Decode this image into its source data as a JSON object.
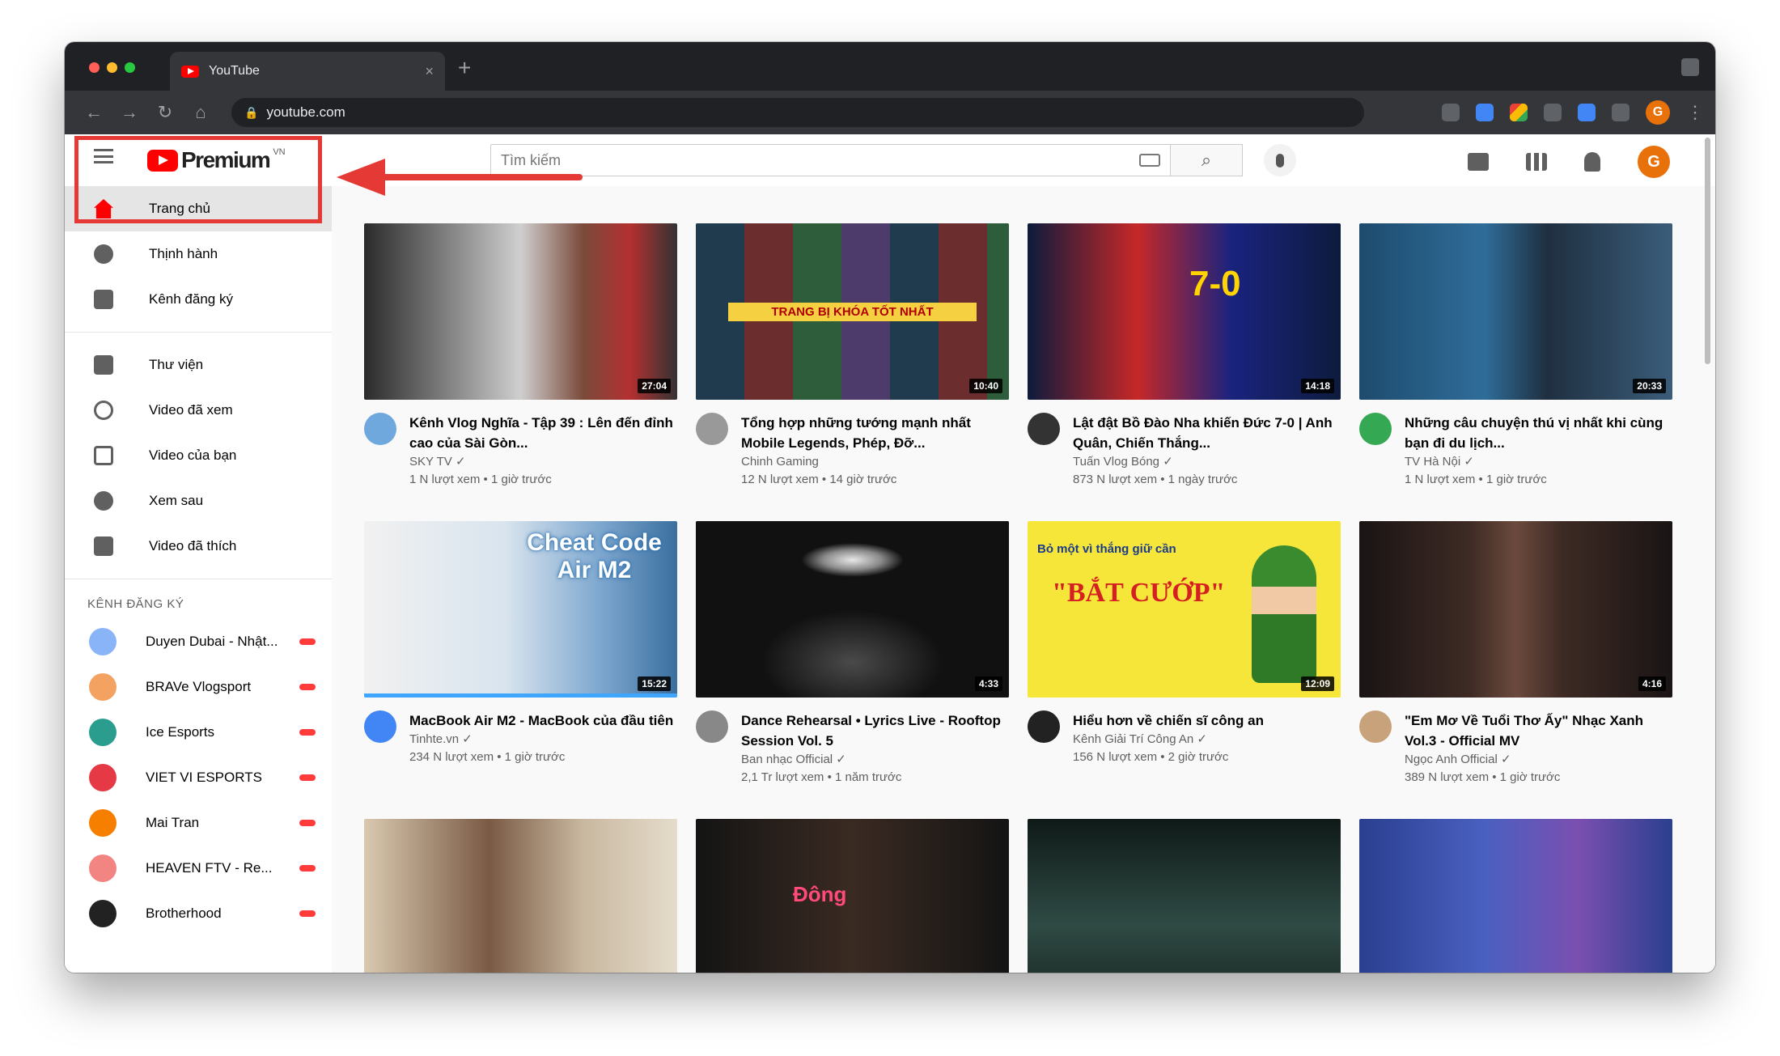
{
  "browser": {
    "tab_title": "YouTube",
    "tab_close": "×",
    "new_tab": "+",
    "url": "youtube.com",
    "profile_initial": "G",
    "traffic_colors": [
      "#ff5f57",
      "#febc2e",
      "#28c840"
    ]
  },
  "youtube": {
    "logo_text": "Premium",
    "region": "VN",
    "search_placeholder": "Tìm kiếm",
    "account_initial": "G",
    "sidebar_primary": [
      {
        "label": "Trang chủ",
        "icon": "home-icon"
      },
      {
        "label": "Thịnh hành",
        "icon": "flame-icon"
      },
      {
        "label": "Kênh đăng ký",
        "icon": "subscriptions-icon"
      }
    ],
    "sidebar_library": [
      {
        "label": "Thư viện",
        "icon": "library-icon"
      },
      {
        "label": "Video đã xem",
        "icon": "history-icon"
      },
      {
        "label": "Video của bạn",
        "icon": "your-videos-icon"
      },
      {
        "label": "Xem sau",
        "icon": "clock-icon"
      },
      {
        "label": "Video đã thích",
        "icon": "thumbs-up-icon"
      }
    ],
    "subscriptions_header": "KÊNH ĐĂNG KÝ",
    "subscriptions": [
      {
        "label": "Duyen Dubai - Nhật...",
        "color": "#8ab4f8"
      },
      {
        "label": "BRAVe Vlogsport",
        "color": "#f4a261"
      },
      {
        "label": "Ice Esports",
        "color": "#2a9d8f"
      },
      {
        "label": "VIET VI ESPORTS",
        "color": "#e63946"
      },
      {
        "label": "Mai Tran",
        "color": "#f77f00"
      },
      {
        "label": "HEAVEN FTV - Re...",
        "color": "#f28482"
      },
      {
        "label": "Brotherhood",
        "color": "#222222"
      }
    ],
    "videos": [
      {
        "title": "Kênh Vlog Nghĩa - Tập 39 : Lên đến đỉnh cao của Sài Gòn...",
        "channel": "SKY TV ✓",
        "stats": "1 N lượt xem • 1 giờ trước",
        "duration": "27:04",
        "channel_color": "#6fa8dc"
      },
      {
        "title": "Tổng hợp những tướng mạnh nhất Mobile Legends, Phép, Đỡ...",
        "channel": "Chinh Gaming",
        "stats": "12 N lượt xem • 14 giờ trước",
        "duration": "10:40",
        "channel_color": "#999999"
      },
      {
        "title": "Lật đật Bồ Đào Nha khiến Đức 7-0 | Anh Quân, Chiến Thắng...",
        "channel": "Tuấn Vlog Bóng ✓",
        "stats": "873 N lượt xem • 1 ngày trước",
        "duration": "14:18",
        "channel_color": "#333333"
      },
      {
        "title": "Những câu chuyện thú vị nhất khi cùng bạn đi du lịch...",
        "channel": "TV Hà Nội ✓",
        "stats": "1 N lượt xem • 1 giờ trước",
        "duration": "20:33",
        "channel_color": "#34a853"
      },
      {
        "title": "MacBook Air M2 - MacBook của đầu tiên",
        "channel": "Tinhte.vn ✓",
        "stats": "234 N lượt xem • 1 giờ trước",
        "duration": "15:22",
        "channel_color": "#4285f4",
        "progress": 1.0
      },
      {
        "title": "Dance Rehearsal • Lyrics Live - Rooftop Session Vol. 5",
        "channel": "Ban nhạc Official ✓",
        "stats": "2,1 Tr lượt xem • 1 năm trước",
        "duration": "4:33",
        "channel_color": "#888888"
      },
      {
        "title": "Hiểu hơn về chiến sĩ công an",
        "channel": "Kênh Giải Trí Công An ✓",
        "stats": "156 N lượt xem • 2 giờ trước",
        "duration": "12:09",
        "channel_color": "#222222"
      },
      {
        "title": "\"Em Mơ Về Tuổi Thơ Ấy\" Nhạc Xanh Vol.3 - Official MV",
        "channel": "Ngọc Anh Official ✓",
        "stats": "389 N lượt xem • 1 giờ trước",
        "duration": "4:16",
        "channel_color": "#c8a27a"
      },
      {
        "title": "",
        "channel": "",
        "stats": "",
        "duration": "",
        "channel_color": "#cccccc"
      },
      {
        "title": "",
        "channel": "",
        "stats": "",
        "duration": "",
        "channel_color": "#cccccc"
      },
      {
        "title": "",
        "channel": "",
        "stats": "",
        "duration": "",
        "channel_color": "#cccccc"
      },
      {
        "title": "",
        "channel": "",
        "stats": "",
        "duration": "",
        "channel_color": "#cccccc"
      }
    ],
    "thumb_captions": {
      "v2": "TRANG BỊ KHÓA TỐT NHẤT",
      "v3_score": "7-0",
      "v5": "Cheat Code Air M2",
      "v7_top": "Bỏ một vì thắng giữ cần",
      "v7_main": "\"BẮT CƯỚP\"",
      "v10": "Đông"
    }
  }
}
